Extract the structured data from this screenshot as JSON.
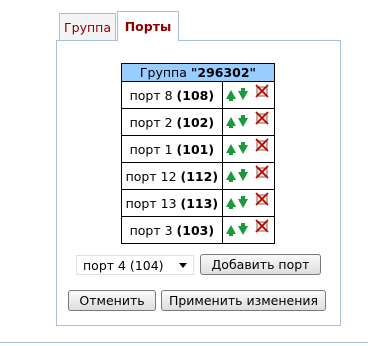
{
  "tabs": [
    {
      "label": "Группа"
    },
    {
      "label": "Порты"
    }
  ],
  "table": {
    "header_prefix": "Группа ",
    "header_group": "\"296302\"",
    "rows": [
      {
        "name": "порт 8",
        "num": "(108)"
      },
      {
        "name": "порт 2",
        "num": "(102)"
      },
      {
        "name": "порт 1",
        "num": "(101)"
      },
      {
        "name": "порт 12",
        "num": "(112)"
      },
      {
        "name": "порт 13",
        "num": "(113)"
      },
      {
        "name": "порт 3",
        "num": "(103)"
      }
    ]
  },
  "controls": {
    "select_value": "порт 4 (104)",
    "add_label": "Добавить порт",
    "cancel_label": "Отменить",
    "apply_label": "Применить изменения"
  },
  "colors": {
    "header_bg": "#99ccff",
    "tab_text": "#8b0000",
    "arrow": "#1a9a3a",
    "panel_border": "#a3c1dd"
  },
  "icons": [
    "arrow-up-icon",
    "arrow-down-icon",
    "delete-icon"
  ]
}
